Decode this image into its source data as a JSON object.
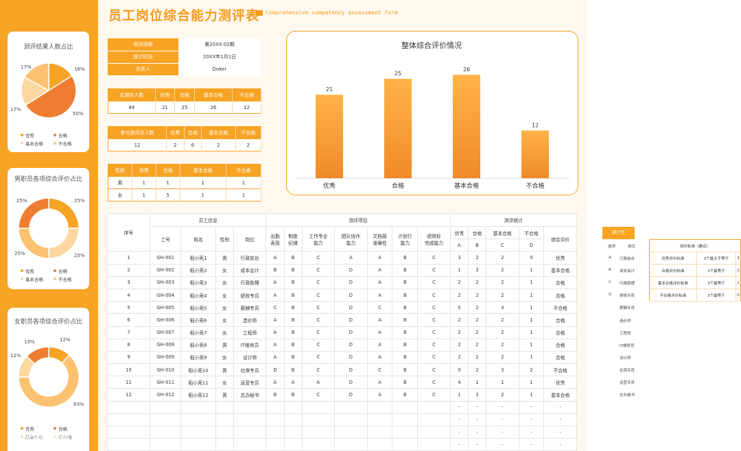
{
  "header": {
    "title": "员工岗位综合能力测评表",
    "subtitle": "Comprehensive competency assessment form"
  },
  "colors": {
    "accent": "#f7a323",
    "dark": "#ee7d31",
    "light": "#fcc271",
    "pale": "#fdd7a0"
  },
  "side_cards": [
    {
      "title": "测评结果人数占比",
      "type": "pie",
      "labels": [
        "16%",
        "50%",
        "17%",
        "17%"
      ],
      "values": [
        16,
        50,
        17,
        17
      ]
    },
    {
      "title": "男职员各项综合评价占比",
      "type": "donut",
      "labels": [
        "25%",
        "25%",
        "25%",
        "25%"
      ],
      "values": [
        25,
        25,
        25,
        25
      ]
    },
    {
      "title": "女职员各项综合评价占比",
      "type": "donut",
      "labels": [
        "12%",
        "63%",
        "12%",
        "13%"
      ],
      "values": [
        12,
        63,
        12,
        13
      ]
    }
  ],
  "legend": [
    "优秀",
    "合格",
    "基本合格",
    "不合格"
  ],
  "info": {
    "rows": [
      [
        "测评周期",
        "第20XX-02期"
      ],
      [
        "统计时间",
        "20XX年1月1日"
      ],
      [
        "负责人",
        "Doker"
      ]
    ]
  },
  "summary_total": {
    "headers": [
      "总测评人数",
      "优秀",
      "合格",
      "基本合格",
      "不合格"
    ],
    "values": [
      "84",
      "21",
      "25",
      "26",
      "12"
    ]
  },
  "summary_participants": {
    "headers": [
      "参与测评总人数",
      "优秀",
      "合格",
      "基本合格",
      "不合格"
    ],
    "values": [
      "12",
      "2",
      "6",
      "2",
      "2"
    ]
  },
  "gender_table": {
    "headers": [
      "性别",
      "优秀",
      "合格",
      "基本合格",
      "不合格"
    ],
    "rows": [
      [
        "男",
        "1",
        "1",
        "1",
        "1"
      ],
      [
        "女",
        "1",
        "5",
        "1",
        "1"
      ]
    ]
  },
  "chart_data": {
    "type": "bar",
    "title": "整体综合评价情况",
    "categories": [
      "优秀",
      "合格",
      "基本合格",
      "不合格"
    ],
    "values": [
      21,
      25,
      26,
      12
    ],
    "ylim": [
      0,
      30
    ]
  },
  "main_table": {
    "group_headers": {
      "index": "序号",
      "employee_info": "员工信息",
      "items": "测评项目",
      "stats": "测评统计"
    },
    "columns": [
      "工号",
      "姓名",
      "性别",
      "岗位",
      "出勤表现",
      "制度纪律",
      "工作专业能力",
      "团队协作能力",
      "文档报准确性",
      "计划行能力",
      "绩效标完成能力",
      "优秀",
      "合格",
      "基本合格",
      "不合格",
      "综合评价"
    ],
    "col_display": [
      "工号",
      "姓名",
      "性别",
      "岗位",
      "出勤\n表现",
      "制度\n纪律",
      "工作专业\n能力",
      "团队协作\n能力",
      "文档报\n准确性",
      "计划行\n能力",
      "绩效标\n完成能力"
    ],
    "stat_sub": [
      "优秀",
      "合格",
      "基本合格",
      "不合格"
    ],
    "stat_letters": [
      "A",
      "B",
      "C",
      "D"
    ],
    "overall": "综合评价",
    "rows": [
      [
        "1",
        "GH-001",
        "稻小壳1",
        "男",
        "行政前台",
        "A",
        "B",
        "C",
        "A",
        "A",
        "B",
        "C",
        "3",
        "2",
        "2",
        "0",
        "优秀"
      ],
      [
        "2",
        "GH-002",
        "稻小壳2",
        "女",
        "成本会计",
        "B",
        "B",
        "C",
        "D",
        "A",
        "B",
        "C",
        "1",
        "3",
        "2",
        "1",
        "基本合格"
      ],
      [
        "3",
        "GH-003",
        "稻小壳3",
        "女",
        "行政助理",
        "A",
        "B",
        "C",
        "D",
        "A",
        "B",
        "C",
        "2",
        "2",
        "2",
        "1",
        "合格"
      ],
      [
        "4",
        "GH-004",
        "稻小壳4",
        "女",
        "绩效专员",
        "A",
        "B",
        "C",
        "D",
        "A",
        "B",
        "C",
        "2",
        "2",
        "2",
        "1",
        "合格"
      ],
      [
        "5",
        "GH-005",
        "稻小壳5",
        "女",
        "薪酬专员",
        "C",
        "B",
        "C",
        "D",
        "C",
        "B",
        "C",
        "0",
        "2",
        "4",
        "1",
        "不合格"
      ],
      [
        "6",
        "GH-006",
        "稻小壳6",
        "女",
        "造价师",
        "A",
        "B",
        "C",
        "D",
        "A",
        "B",
        "C",
        "2",
        "2",
        "2",
        "1",
        "合格"
      ],
      [
        "7",
        "GH-007",
        "稻小壳7",
        "女",
        "工程师",
        "A",
        "B",
        "C",
        "D",
        "A",
        "B",
        "C",
        "2",
        "2",
        "2",
        "1",
        "合格"
      ],
      [
        "8",
        "GH-008",
        "稻小壳8",
        "男",
        "IT维修员",
        "A",
        "B",
        "C",
        "D",
        "A",
        "B",
        "C",
        "2",
        "2",
        "2",
        "1",
        "合格"
      ],
      [
        "9",
        "GH-009",
        "稻小壳9",
        "女",
        "设计师",
        "A",
        "B",
        "C",
        "D",
        "A",
        "B",
        "C",
        "2",
        "2",
        "2",
        "1",
        "合格"
      ],
      [
        "10",
        "GH-010",
        "稻小壳10",
        "男",
        "社保专员",
        "D",
        "B",
        "C",
        "D",
        "C",
        "B",
        "C",
        "0",
        "2",
        "3",
        "2",
        "不合格"
      ],
      [
        "11",
        "GH-011",
        "稻小壳11",
        "女",
        "运营专员",
        "A",
        "A",
        "A",
        "D",
        "A",
        "B",
        "C",
        "4",
        "1",
        "1",
        "1",
        "优秀"
      ],
      [
        "12",
        "GH-012",
        "稻小壳12",
        "男",
        "总办秘书",
        "B",
        "B",
        "C",
        "D",
        "A",
        "B",
        "C",
        "1",
        "3",
        "2",
        "1",
        "基本合格"
      ]
    ],
    "empty_rows": 4,
    "dash": "-"
  },
  "side_list": {
    "header": "统计列",
    "subheaders": [
      "选项",
      "岗位"
    ],
    "rows": [
      [
        "A",
        "行政前台"
      ],
      [
        "B",
        "成本会计"
      ],
      [
        "C",
        "行政助理"
      ],
      [
        "D",
        "绩效专员"
      ],
      [
        "",
        "薪酬专员"
      ],
      [
        "",
        "造价师"
      ],
      [
        "",
        "工程师"
      ],
      [
        "",
        "IT维修员"
      ],
      [
        "",
        "设计师"
      ],
      [
        "",
        "社保专员"
      ],
      [
        "",
        "运营专员"
      ],
      [
        "",
        "总办秘书"
      ]
    ]
  },
  "rule_table": {
    "title": "测评标准（建议）",
    "rows": [
      [
        "优秀评价标准",
        "3个最大于等于",
        "3"
      ],
      [
        "合格评价标准",
        "3个最等于",
        "2"
      ],
      [
        "基本合格评价标准",
        "3个最等于",
        "1"
      ],
      [
        "不合格评价标准",
        "3个最等于",
        "0"
      ]
    ]
  },
  "watermark": "大数据锦"
}
